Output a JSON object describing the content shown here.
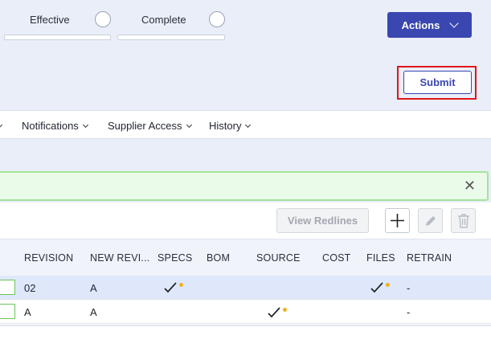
{
  "stages": [
    {
      "label": "Effective"
    },
    {
      "label": "Complete"
    }
  ],
  "header": {
    "actions_label": "Actions",
    "submit_label": "Submit"
  },
  "tabs": [
    {
      "label": "Notifications"
    },
    {
      "label": "Supplier Access"
    },
    {
      "label": "History"
    }
  ],
  "toolbar": {
    "view_redlines_label": "View Redlines"
  },
  "table": {
    "columns": [
      "REVISION",
      "NEW REVI...",
      "SPECS",
      "BOM",
      "SOURCE",
      "COST",
      "FILES",
      "RETRAIN"
    ],
    "rows": [
      {
        "revision": "02",
        "new_revision": "A",
        "specs": "check",
        "source": "",
        "files": "check",
        "retrain": "-"
      },
      {
        "revision": "A",
        "new_revision": "A",
        "specs": "",
        "source": "check",
        "files": "",
        "retrain": "-"
      }
    ]
  },
  "colors": {
    "primary": "#3a47b0",
    "highlight_border": "#e0151b",
    "alert_border": "#a6e39a",
    "dot": "#f2b01e"
  }
}
